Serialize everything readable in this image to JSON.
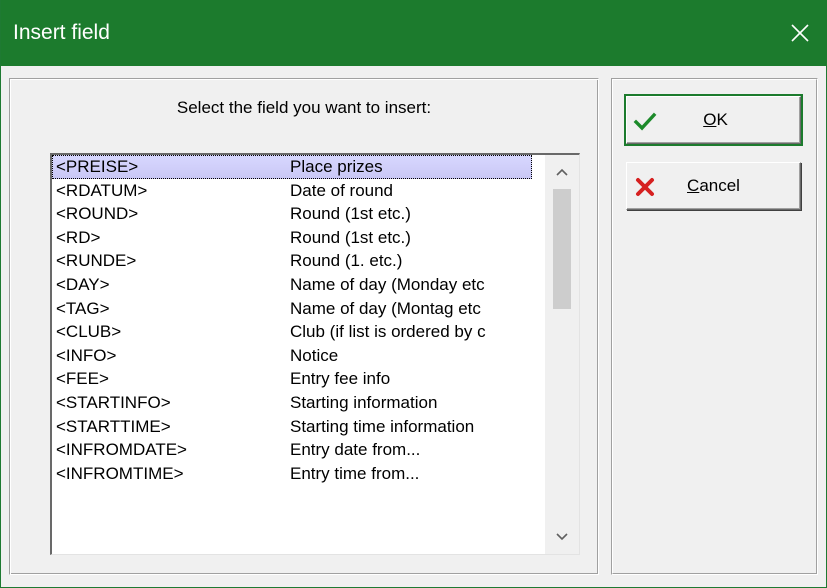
{
  "window": {
    "title": "Insert field",
    "title_bar_color": "#1c7b2d"
  },
  "close_icon": "close-icon",
  "prompt": "Select the field you want to insert:",
  "fields": [
    {
      "code": "<PREISE>",
      "desc": "Place prizes"
    },
    {
      "code": "<RDATUM>",
      "desc": "Date of round"
    },
    {
      "code": "<ROUND>",
      "desc": "Round (1st etc.)"
    },
    {
      "code": "<RD>",
      "desc": "Round (1st etc.)"
    },
    {
      "code": "<RUNDE>",
      "desc": "Round (1. etc.)"
    },
    {
      "code": "<DAY>",
      "desc": "Name of day (Monday etc"
    },
    {
      "code": "<TAG>",
      "desc": "Name of day (Montag etc"
    },
    {
      "code": "<CLUB>",
      "desc": "Club (if list is ordered by c"
    },
    {
      "code": "<INFO>",
      "desc": "Notice"
    },
    {
      "code": "<FEE>",
      "desc": "Entry fee info"
    },
    {
      "code": "<STARTINFO>",
      "desc": "Starting information"
    },
    {
      "code": "<STARTTIME>",
      "desc": "Starting time information"
    },
    {
      "code": "<INFROMDATE>",
      "desc": "Entry date from..."
    },
    {
      "code": "<INFROMTIME>",
      "desc": "Entry time from..."
    }
  ],
  "selected_index": 0,
  "buttons": {
    "ok": {
      "accel": "O",
      "rest": "K",
      "icon": "checkmark-icon",
      "icon_color": "#1c8a2a"
    },
    "cancel": {
      "accel": "C",
      "rest": "ancel",
      "icon": "cross-icon",
      "icon_color": "#d62020"
    }
  }
}
